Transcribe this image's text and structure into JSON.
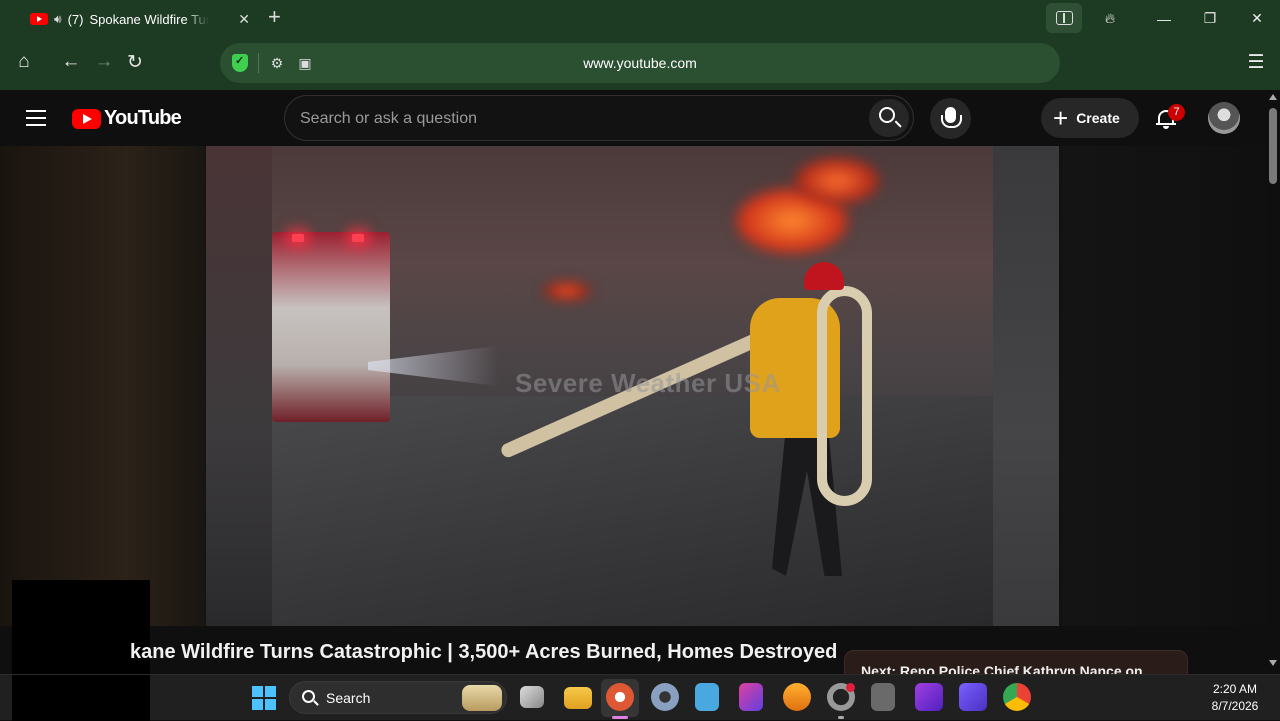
{
  "browser": {
    "tab": {
      "audio_icon": "speaker-icon",
      "count": "(7)",
      "title": "Spokane Wildfire Turns Catastrophic"
    },
    "url": "www.youtube.com"
  },
  "youtube": {
    "logo_text": "YouTube",
    "search_placeholder": "Search or ask a question",
    "create_label": "Create",
    "notification_count": "7"
  },
  "video": {
    "watermark": "Severe Weather USA",
    "title": "kane Wildfire Turns Catastrophic | 3,500+ Acres Burned, Homes Destroyed",
    "next_up": "Next: Reno Police Chief Kathryn Nance on"
  },
  "taskbar": {
    "search_label": "Search",
    "time": "2:20 AM",
    "date": "8/7/2026"
  },
  "colors": {
    "browser_chrome": "#1d3a22",
    "yt_red": "#ff0000",
    "background": "#0f0f0f"
  }
}
